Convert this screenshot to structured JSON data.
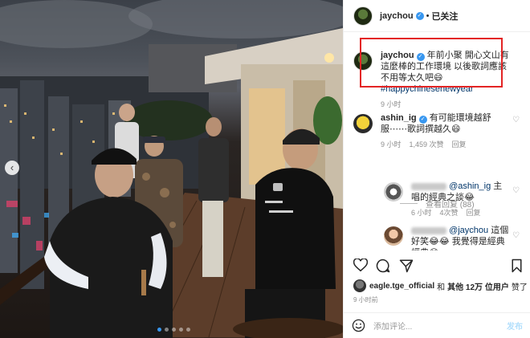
{
  "header": {
    "username": "jaychou",
    "separator": "•",
    "follow_label": "已关注"
  },
  "caption": {
    "username": "jaychou",
    "text": "年前小聚 開心文山有這麼棒的工作環境 以後歌詞應該不用等太久吧😄",
    "hashtag": "#happychinesenewyear",
    "time": "9 小时"
  },
  "comments": [
    {
      "username": "ashin_ig",
      "text": "有可能環境越舒服⋯⋯歌詞撰越久😄",
      "time": "9 小时",
      "likes": "1,459 次赞",
      "reply": "回复"
    }
  ],
  "view_replies": "查看回复 (88)",
  "replies": [
    {
      "mention": "@ashin_ig",
      "text_a": "主",
      "text_b": "唱的經典之談😂",
      "time": "6 小时",
      "likes": "4次赞",
      "reply": "回复"
    },
    {
      "mention": "@jaychou",
      "text": "這個好笑😂😂 我覺得是經典經典😂"
    }
  ],
  "likes_line": {
    "user": "eagle.tge_official",
    "connector": "和",
    "others": "其他 12万 位用户",
    "suffix": "赞了"
  },
  "post_time": "9 小时前",
  "add_comment": {
    "placeholder": "添加评论...",
    "post_label": "发布"
  },
  "icons": {
    "verified": "verified-badge-icon",
    "like": "heart-icon",
    "comment": "speech-bubble-icon",
    "share": "paper-plane-icon",
    "save": "bookmark-icon",
    "emoji": "smiley-icon",
    "prev": "chevron-left-icon"
  },
  "colors": {
    "link": "#003569",
    "verified": "#3897f0",
    "highlight_box": "#e32424",
    "muted": "#8e8e8e",
    "post_disabled": "#b2dffc"
  },
  "carousel": {
    "total_slides": 5,
    "active_slide": 1
  }
}
